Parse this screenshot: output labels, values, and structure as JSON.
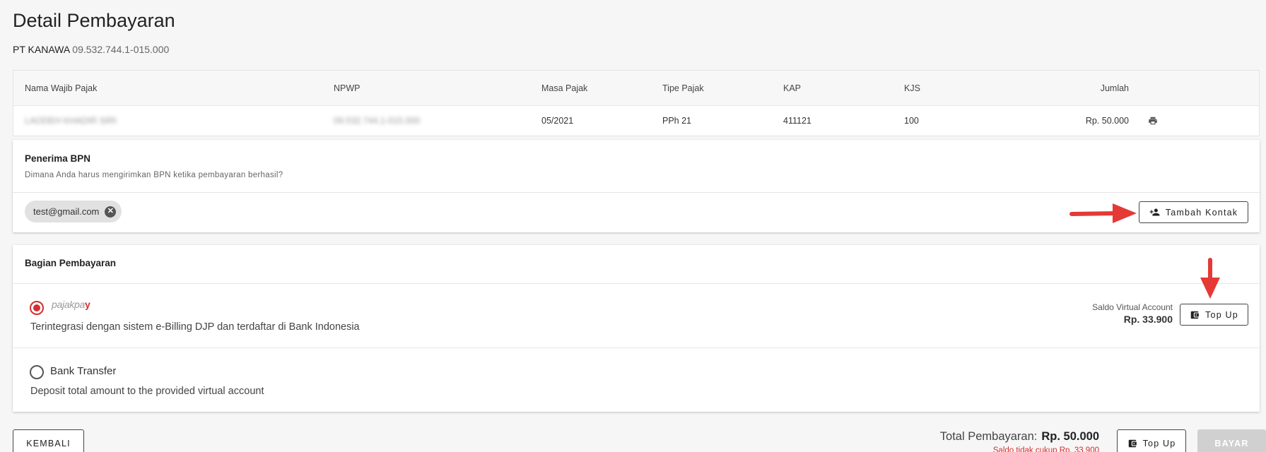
{
  "page": {
    "title": "Detail Pembayaran"
  },
  "company": {
    "name": "PT KANAWA",
    "npwp": "09.532.744.1-015.000"
  },
  "table": {
    "headers": [
      "Nama Wajib Pajak",
      "NPWP",
      "Masa Pajak",
      "Tipe Pajak",
      "KAP",
      "KJS",
      "Jumlah"
    ],
    "row": {
      "nama": "LAODEH KHADIR SIRI",
      "npwp": "09.532.744.1-015.000",
      "masa_pajak": "05/2021",
      "tipe_pajak": "PPh 21",
      "kap": "411121",
      "kjs": "100",
      "jumlah": "Rp. 50.000"
    },
    "print_icon": "printer-icon"
  },
  "penerima": {
    "title": "Penerima BPN",
    "subtitle": "Dimana Anda harus mengirimkan BPN ketika pembayaran berhasil?",
    "chips": [
      "test@gmail.com"
    ],
    "add_contact_label": "Tambah Kontak"
  },
  "payment": {
    "title": "Bagian Pembayaran",
    "options": [
      {
        "logo_text": "pajakpa",
        "logo_mark": "y",
        "description": "Terintegrasi dengan sistem e-Billing DJP dan terdaftar di Bank Indonesia",
        "selected": true
      },
      {
        "label": "Bank Transfer",
        "description": "Deposit total amount to the provided virtual account",
        "selected": false
      }
    ],
    "saldo_label": "Saldo Virtual Account",
    "saldo_value": "Rp. 33.900",
    "topup_label": "Top Up"
  },
  "footer": {
    "back_label": "KEMBALI",
    "total_label": "Total Pembayaran:",
    "total_value": "Rp. 50.000",
    "warning": "Saldo tidak cukup Rp. 33.900",
    "topup_label": "Top Up",
    "pay_label": "BAYAR"
  },
  "colors": {
    "accent": "#d32f2f",
    "annotation_arrow": "#e53935",
    "disabled": "#d0d0d0"
  }
}
